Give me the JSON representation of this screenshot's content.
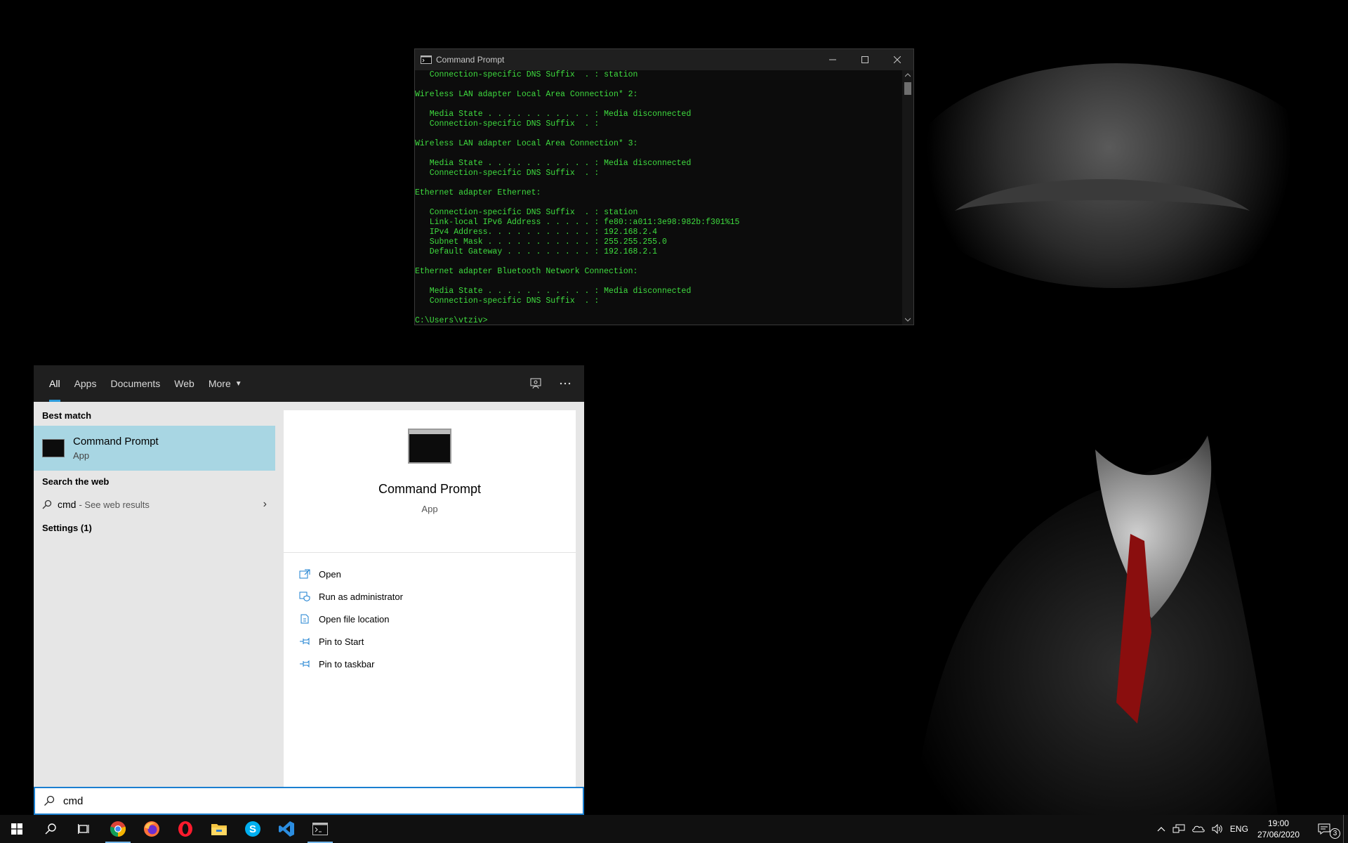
{
  "cmd_window": {
    "title": "Command Prompt",
    "output": "   Connection-specific DNS Suffix  . : station\n\nWireless LAN adapter Local Area Connection* 2:\n\n   Media State . . . . . . . . . . . : Media disconnected\n   Connection-specific DNS Suffix  . :\n\nWireless LAN adapter Local Area Connection* 3:\n\n   Media State . . . . . . . . . . . : Media disconnected\n   Connection-specific DNS Suffix  . :\n\nEthernet adapter Ethernet:\n\n   Connection-specific DNS Suffix  . : station\n   Link-local IPv6 Address . . . . . : fe80::a011:3e98:982b:f301%15\n   IPv4 Address. . . . . . . . . . . : 192.168.2.4\n   Subnet Mask . . . . . . . . . . . : 255.255.255.0\n   Default Gateway . . . . . . . . . : 192.168.2.1\n\nEthernet adapter Bluetooth Network Connection:\n\n   Media State . . . . . . . . . . . : Media disconnected\n   Connection-specific DNS Suffix  . :\n\nC:\\Users\\vtziv>",
    "text_color": "#3fdc3f"
  },
  "search_panel": {
    "tabs": [
      "All",
      "Apps",
      "Documents",
      "Web",
      "More"
    ],
    "active_tab": "All",
    "best_match_heading": "Best match",
    "best_match": {
      "title": "Command Prompt",
      "subtitle": "App"
    },
    "web_heading": "Search the web",
    "web_result": {
      "query": "cmd",
      "suffix": "- See web results"
    },
    "settings_heading": "Settings (1)",
    "detail": {
      "title": "Command Prompt",
      "subtitle": "App",
      "actions": [
        "Open",
        "Run as administrator",
        "Open file location",
        "Pin to Start",
        "Pin to taskbar"
      ]
    },
    "search_value": "cmd",
    "accent_color": "#2d9cdb",
    "highlight_color": "#a8d6e3"
  },
  "taskbar": {
    "apps": [
      "start-icon",
      "search-icon",
      "task-view-icon",
      "chrome-icon",
      "firefox-icon",
      "opera-icon",
      "file-explorer-icon",
      "skype-icon",
      "vscode-icon",
      "command-prompt-icon"
    ],
    "language": "ENG",
    "time": "19:00",
    "date": "27/06/2020",
    "notification_count": "3"
  }
}
